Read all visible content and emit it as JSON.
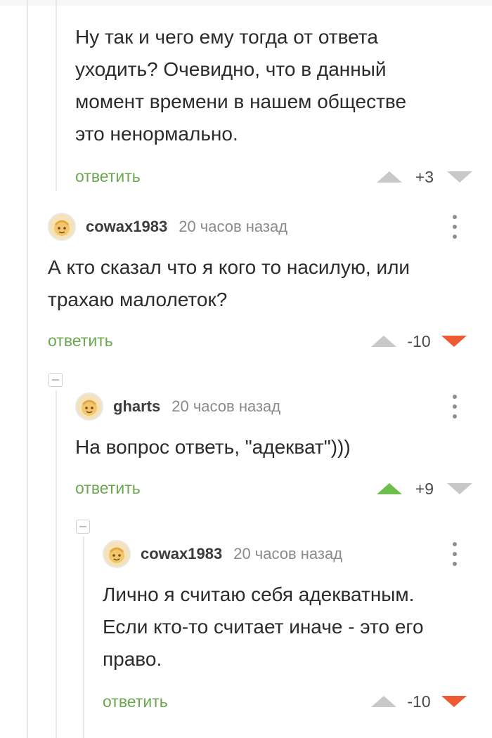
{
  "colors": {
    "reply_green": "#6aa84f",
    "upvote_active": "#6cbf4a",
    "downvote_active": "#ef5a35",
    "vote_inactive": "#c8c8c8"
  },
  "comments": [
    {
      "text_lines": [
        "Ну так и чего ему тогда от ответа",
        "уходить? Очевидно, что в данный",
        "момент времени в нашем обществе",
        "это ненормально."
      ],
      "reply_label": "ответить",
      "score": "+3",
      "vote_state": "none"
    },
    {
      "username": "cowax1983",
      "time": "20 часов назад",
      "avatar_icon": "avatar-face-icon",
      "text_lines": [
        "А кто сказал что я кого то насилую, или",
        "трахаю малолеток?"
      ],
      "reply_label": "ответить",
      "score": "-10",
      "vote_state": "down"
    },
    {
      "username": "gharts",
      "time": "20 часов назад",
      "avatar_icon": "avatar-face-icon",
      "text_lines": [
        "На вопрос ответь, \"адекват\")))"
      ],
      "reply_label": "ответить",
      "score": "+9",
      "vote_state": "up"
    },
    {
      "username": "cowax1983",
      "time": "20 часов назад",
      "avatar_icon": "avatar-face-icon",
      "text_lines": [
        "Лично я считаю себя адекватным.",
        "Если кто-то считает иначе - это его",
        "право."
      ],
      "reply_label": "ответить",
      "score": "-10",
      "vote_state": "down"
    }
  ]
}
